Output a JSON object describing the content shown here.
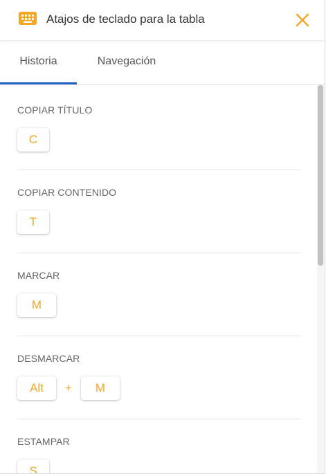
{
  "header": {
    "icon": "keyboard-icon",
    "title": "Atajos de teclado para la tabla",
    "close_icon": "close-icon",
    "accent_color": "#f5a623"
  },
  "tabs": [
    {
      "label": "Historia",
      "active": true
    },
    {
      "label": "Navegación",
      "active": false
    }
  ],
  "tab_indicator_color": "#1f5fbf",
  "sections": [
    {
      "title": "COPIAR TÍTULO",
      "keys": [
        "C"
      ]
    },
    {
      "title": "COPIAR CONTENIDO",
      "keys": [
        "T"
      ]
    },
    {
      "title": "MARCAR",
      "keys": [
        "M"
      ]
    },
    {
      "title": "DESMARCAR",
      "keys": [
        "Alt",
        "M"
      ],
      "separator": "+"
    },
    {
      "title": "ESTAMPAR",
      "keys": [
        "S"
      ]
    }
  ]
}
